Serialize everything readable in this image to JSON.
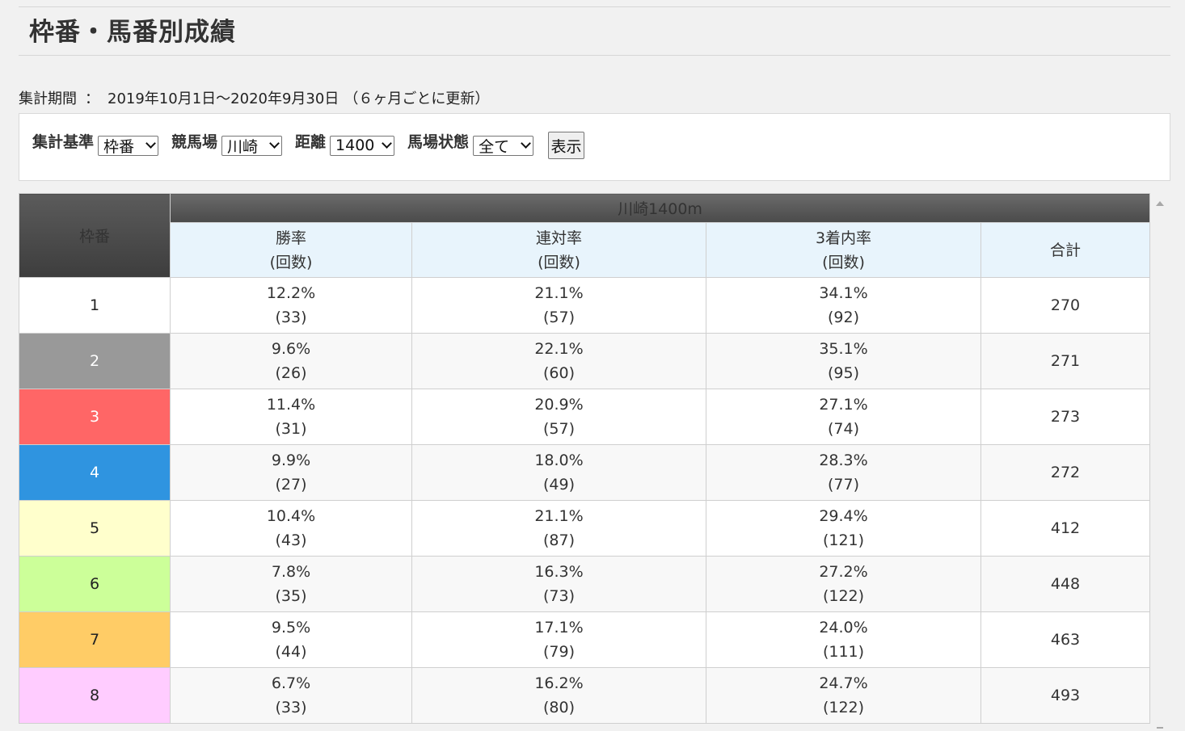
{
  "page": {
    "title": "枠番・馬番別成績"
  },
  "period": {
    "label": "集計期間",
    "separator": "：",
    "value": "2019年10月1日～2020年9月30日",
    "note": "（６ヶ月ごとに更新）"
  },
  "filters": {
    "basis_label": "集計基準",
    "basis_value": "枠番",
    "course_label": "競馬場",
    "course_value": "川崎",
    "distance_label": "距離",
    "distance_value": "1400",
    "condition_label": "馬場状態",
    "condition_value": "全て",
    "show_button": "表示"
  },
  "table": {
    "frame_header": "枠番",
    "course_header": "川崎1400m",
    "columns": [
      {
        "line1": "勝率",
        "line2": "(回数)"
      },
      {
        "line1": "連対率",
        "line2": "(回数)"
      },
      {
        "line1": "3着内率",
        "line2": "(回数)"
      },
      {
        "line1": "合計",
        "line2": ""
      }
    ],
    "rows": [
      {
        "frame": "1",
        "bg": "#ffffff",
        "fg": "#222222",
        "win": "12.2%",
        "win_n": "(33)",
        "quinella": "21.1%",
        "quinella_n": "(57)",
        "place": "34.1%",
        "place_n": "(92)",
        "total": "270"
      },
      {
        "frame": "2",
        "bg": "#999999",
        "fg": "#ffffff",
        "win": "9.6%",
        "win_n": "(26)",
        "quinella": "22.1%",
        "quinella_n": "(60)",
        "place": "35.1%",
        "place_n": "(95)",
        "total": "271"
      },
      {
        "frame": "3",
        "bg": "#ff6666",
        "fg": "#ffffff",
        "win": "11.4%",
        "win_n": "(31)",
        "quinella": "20.9%",
        "quinella_n": "(57)",
        "place": "27.1%",
        "place_n": "(74)",
        "total": "273"
      },
      {
        "frame": "4",
        "bg": "#2f94e0",
        "fg": "#ffffff",
        "win": "9.9%",
        "win_n": "(27)",
        "quinella": "18.0%",
        "quinella_n": "(49)",
        "place": "28.3%",
        "place_n": "(77)",
        "total": "272"
      },
      {
        "frame": "5",
        "bg": "#ffffcc",
        "fg": "#222222",
        "win": "10.4%",
        "win_n": "(43)",
        "quinella": "21.1%",
        "quinella_n": "(87)",
        "place": "29.4%",
        "place_n": "(121)",
        "total": "412"
      },
      {
        "frame": "6",
        "bg": "#ccff99",
        "fg": "#222222",
        "win": "7.8%",
        "win_n": "(35)",
        "quinella": "16.3%",
        "quinella_n": "(73)",
        "place": "27.2%",
        "place_n": "(122)",
        "total": "448"
      },
      {
        "frame": "7",
        "bg": "#ffcc66",
        "fg": "#222222",
        "win": "9.5%",
        "win_n": "(44)",
        "quinella": "17.1%",
        "quinella_n": "(79)",
        "place": "24.0%",
        "place_n": "(111)",
        "total": "463"
      },
      {
        "frame": "8",
        "bg": "#ffccff",
        "fg": "#222222",
        "win": "6.7%",
        "win_n": "(33)",
        "quinella": "16.2%",
        "quinella_n": "(80)",
        "place": "24.7%",
        "place_n": "(122)",
        "total": "493"
      }
    ]
  },
  "icons": {
    "scroll_up": "scroll-up-arrow-icon",
    "scroll_down": "scroll-down-arrow-icon",
    "dropdown": "chevron-down-icon"
  }
}
